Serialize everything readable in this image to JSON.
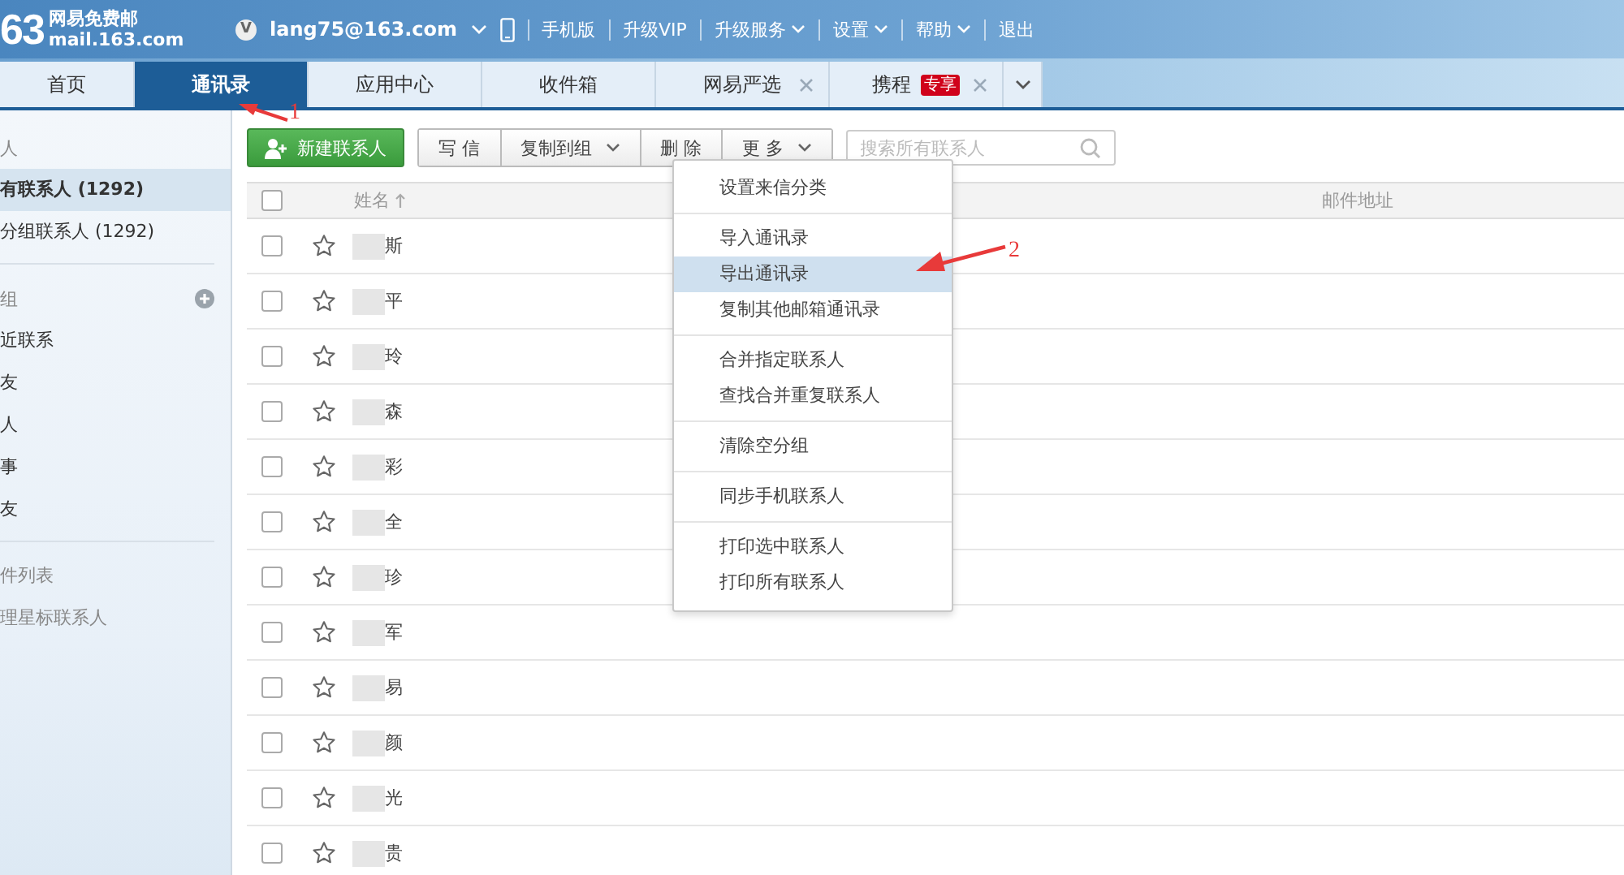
{
  "header": {
    "logo_number": "63",
    "logo_title": "网易免费邮",
    "logo_domain": "mail.163.com",
    "avatar_letter": "V",
    "account": "lang75@163.com",
    "nav_links": [
      {
        "label": "手机版",
        "dropdown": false
      },
      {
        "label": "升级VIP",
        "dropdown": false
      },
      {
        "label": "升级服务",
        "dropdown": true
      },
      {
        "label": "设置",
        "dropdown": true
      },
      {
        "label": "帮助",
        "dropdown": true
      },
      {
        "label": "退出",
        "dropdown": false
      }
    ]
  },
  "tabs": [
    {
      "label": "首页",
      "selected": false,
      "closable": false
    },
    {
      "label": "通讯录",
      "selected": true,
      "closable": false
    },
    {
      "label": "应用中心",
      "selected": false,
      "closable": false
    },
    {
      "label": "收件箱",
      "selected": false,
      "closable": false
    },
    {
      "label": "网易严选",
      "selected": false,
      "closable": true
    },
    {
      "label": "携程",
      "selected": false,
      "closable": true,
      "badge": "专享"
    }
  ],
  "sidebar": {
    "sections": [
      {
        "header": "人",
        "addable": false,
        "items": [
          {
            "label": "有联系人 (1292)",
            "selected": true,
            "muted": false
          },
          {
            "label": "分组联系人 (1292)",
            "selected": false,
            "muted": false
          }
        ]
      },
      {
        "header": "组",
        "addable": true,
        "items": [
          {
            "label": "近联系",
            "selected": false,
            "muted": false
          },
          {
            "label": "友",
            "selected": false,
            "muted": false
          },
          {
            "label": "人",
            "selected": false,
            "muted": false
          },
          {
            "label": "事",
            "selected": false,
            "muted": false
          },
          {
            "label": "友",
            "selected": false,
            "muted": false
          }
        ]
      },
      {
        "items": [
          {
            "label": "件列表",
            "selected": false,
            "muted": true
          },
          {
            "label": "理星标联系人",
            "selected": false,
            "muted": true
          }
        ]
      }
    ]
  },
  "toolbar": {
    "new_button": "新建联系人",
    "buttons": [
      {
        "label": "写 信",
        "dropdown": false
      },
      {
        "label": "复制到组",
        "dropdown": true
      },
      {
        "label": "删 除",
        "dropdown": false
      },
      {
        "label": "更 多",
        "dropdown": true
      }
    ],
    "search": {
      "placeholder": "搜索所有联系人"
    }
  },
  "table": {
    "all_checked": false,
    "name_header": "姓名",
    "email_header": "邮件地址",
    "rows": [
      {
        "name": "斯",
        "checked": false,
        "starred": false
      },
      {
        "name": "平",
        "checked": false,
        "starred": false
      },
      {
        "name": "玲",
        "checked": false,
        "starred": false
      },
      {
        "name": "森",
        "checked": false,
        "starred": false
      },
      {
        "name": "彩",
        "checked": false,
        "starred": false
      },
      {
        "name": "全",
        "checked": false,
        "starred": false
      },
      {
        "name": "珍",
        "checked": false,
        "starred": false
      },
      {
        "name": "军",
        "checked": false,
        "starred": false
      },
      {
        "name": "易",
        "checked": false,
        "starred": false
      },
      {
        "name": "颜",
        "checked": false,
        "starred": false
      },
      {
        "name": "光",
        "checked": false,
        "starred": false
      },
      {
        "name": "贵",
        "checked": false,
        "starred": false
      }
    ]
  },
  "menu": {
    "groups": [
      [
        {
          "label": "设置来信分类",
          "selected": false
        }
      ],
      [
        {
          "label": "导入通讯录",
          "selected": false
        },
        {
          "label": "导出通讯录",
          "selected": true
        },
        {
          "label": "复制其他邮箱通讯录",
          "selected": false
        }
      ],
      [
        {
          "label": "合并指定联系人",
          "selected": false
        },
        {
          "label": "查找合并重复联系人",
          "selected": false
        }
      ],
      [
        {
          "label": "清除空分组",
          "selected": false
        }
      ],
      [
        {
          "label": "同步手机联系人",
          "selected": false
        }
      ],
      [
        {
          "label": "打印选中联系人",
          "selected": false
        },
        {
          "label": "打印所有联系人",
          "selected": false
        }
      ]
    ]
  },
  "annotations": [
    {
      "label": "1"
    },
    {
      "label": "2"
    }
  ]
}
